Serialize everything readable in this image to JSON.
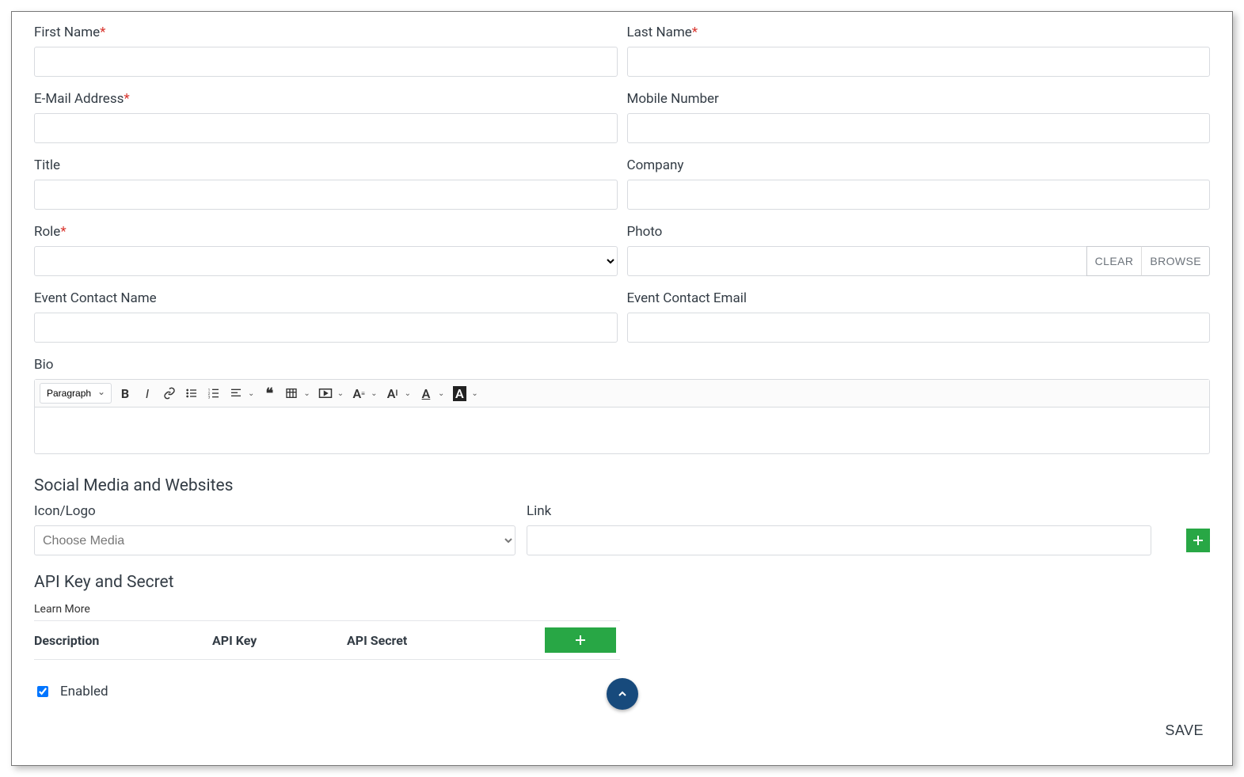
{
  "form": {
    "first_name": {
      "label": "First Name",
      "required": true,
      "value": ""
    },
    "last_name": {
      "label": "Last Name",
      "required": true,
      "value": ""
    },
    "email": {
      "label": "E-Mail Address",
      "required": true,
      "value": ""
    },
    "mobile": {
      "label": "Mobile Number",
      "required": false,
      "value": ""
    },
    "title": {
      "label": "Title",
      "required": false,
      "value": ""
    },
    "company": {
      "label": "Company",
      "required": false,
      "value": ""
    },
    "role": {
      "label": "Role",
      "required": true,
      "value": ""
    },
    "photo": {
      "label": "Photo",
      "required": false,
      "value": "",
      "clear_label": "CLEAR",
      "browse_label": "BROWSE"
    },
    "event_contact_name": {
      "label": "Event Contact Name",
      "required": false,
      "value": ""
    },
    "event_contact_email": {
      "label": "Event Contact Email",
      "required": false,
      "value": ""
    },
    "bio": {
      "label": "Bio",
      "value": ""
    }
  },
  "editor": {
    "block_format": "Paragraph"
  },
  "social": {
    "section_title": "Social Media and Websites",
    "icon_label": "Icon/Logo",
    "icon_placeholder": "Choose Media",
    "link_label": "Link",
    "link_value": ""
  },
  "api": {
    "section_title": "API Key and Secret",
    "learn_more": "Learn More",
    "columns": {
      "description": "Description",
      "key": "API Key",
      "secret": "API Secret"
    }
  },
  "enabled": {
    "label": "Enabled",
    "checked": true
  },
  "save_label": "SAVE",
  "required_marker": "*"
}
